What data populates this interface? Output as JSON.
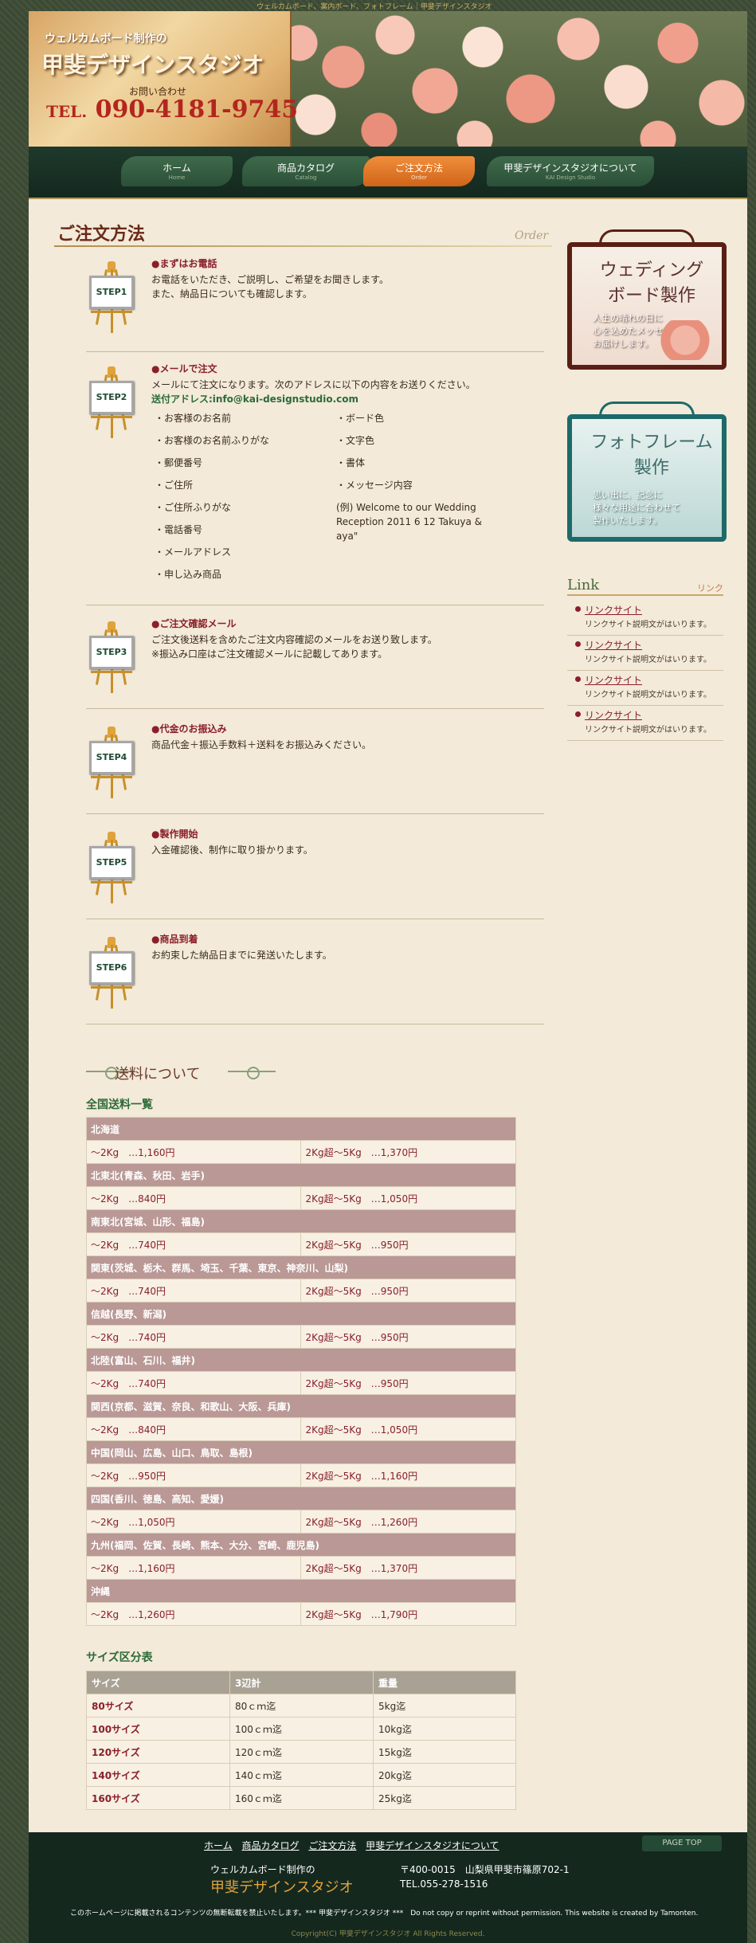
{
  "top_tagline": "ウェルカムボード、案内ボード、フォトフレーム｜甲斐デザインスタジオ",
  "header": {
    "subtitle": "ウェルカムボード制作の",
    "name": "甲斐デザインスタジオ",
    "contact_label": "お問い合わせ",
    "tel_prefix": "TEL.",
    "tel": "090-4181-9745"
  },
  "nav": [
    {
      "label": "ホーム",
      "sub": "Home"
    },
    {
      "label": "商品カタログ",
      "sub": "Catalog"
    },
    {
      "label": "ご注文方法",
      "sub": "Order"
    },
    {
      "label": "甲斐デザインスタジオについて",
      "sub": "KAI Design Studio"
    }
  ],
  "page": {
    "title": "ご注文方法",
    "title_en": "Order"
  },
  "steps": [
    {
      "badge": "STEP1",
      "heading": "●まずはお電話",
      "lines": [
        "お電話をいただき、ご説明し、ご希望をお聞きします。",
        "また、納品日についても確認します。"
      ]
    },
    {
      "badge": "STEP2",
      "heading": "●メールで注文",
      "lines": [
        "メールにて注文になります。次のアドレスに以下の内容をお送りください。"
      ],
      "address": "送付アドレス:info@kai-designstudio.com",
      "items_left": [
        "・お客様のお名前",
        "・お客様のお名前ふりがな",
        "・郵便番号",
        "・ご住所",
        "・ご住所ふりがな",
        "・電話番号",
        "・メールアドレス",
        "・申し込み商品"
      ],
      "items_right": [
        "・ボード色",
        "・文字色",
        "・書体",
        "・メッセージ内容"
      ],
      "example_1": "(例) Welcome to our Wedding",
      "example_2": "Reception 2011 6 12 Takuya &",
      "example_3": "aya\""
    },
    {
      "badge": "STEP3",
      "heading": "●ご注文確認メール",
      "lines": [
        "ご注文後送料を含めたご注文内容確認のメールをお送り致します。",
        "※振込み口座はご注文確認メールに記載してあります。"
      ]
    },
    {
      "badge": "STEP4",
      "heading": "●代金のお振込み",
      "lines": [
        "商品代金＋振込手数料＋送料をお振込みください。"
      ]
    },
    {
      "badge": "STEP5",
      "heading": "●製作開始",
      "lines": [
        "入金確認後、制作に取り掛かります。"
      ]
    },
    {
      "badge": "STEP6",
      "heading": "●商品到着",
      "lines": [
        "お約束した納品日までに発送いたします。"
      ]
    }
  ],
  "shipping": {
    "heading": "送料について",
    "table_title": "全国送料一覧",
    "regions": [
      {
        "name": "北海道",
        "a": "～2Kg　…1,160円",
        "b": "2Kg超～5Kg　…1,370円"
      },
      {
        "name": "北東北(青森、秋田、岩手)",
        "a": "～2Kg　…840円",
        "b": "2Kg超～5Kg　…1,050円"
      },
      {
        "name": "南東北(宮城、山形、福島)",
        "a": "～2Kg　…740円",
        "b": "2Kg超～5Kg　…950円"
      },
      {
        "name": "関東(茨城、栃木、群馬、埼玉、千葉、東京、神奈川、山梨)",
        "a": "～2Kg　…740円",
        "b": "2Kg超～5Kg　…950円"
      },
      {
        "name": "信越(長野、新潟)",
        "a": "～2Kg　…740円",
        "b": "2Kg超～5Kg　…950円"
      },
      {
        "name": "北陸(富山、石川、福井)",
        "a": "～2Kg　…740円",
        "b": "2Kg超～5Kg　…950円"
      },
      {
        "name": "関西(京都、滋賀、奈良、和歌山、大阪、兵庫)",
        "a": "～2Kg　…840円",
        "b": "2Kg超～5Kg　…1,050円"
      },
      {
        "name": "中国(岡山、広島、山口、鳥取、島根)",
        "a": "～2Kg　…950円",
        "b": "2Kg超～5Kg　…1,160円"
      },
      {
        "name": "四国(香川、徳島、高知、愛媛)",
        "a": "～2Kg　…1,050円",
        "b": "2Kg超～5Kg　…1,260円"
      },
      {
        "name": "九州(福岡、佐賀、長崎、熊本、大分、宮崎、鹿児島)",
        "a": "～2Kg　…1,160円",
        "b": "2Kg超～5Kg　…1,370円"
      },
      {
        "name": "沖縄",
        "a": "～2Kg　…1,260円",
        "b": "2Kg超～5Kg　…1,790円"
      }
    ]
  },
  "size": {
    "title": "サイズ区分表",
    "headers": [
      "サイズ",
      "3辺計",
      "重量"
    ],
    "rows": [
      [
        "80サイズ",
        "80ｃｍ迄",
        "5kg迄"
      ],
      [
        "100サイズ",
        "100ｃｍ迄",
        "10kg迄"
      ],
      [
        "120サイズ",
        "120ｃｍ迄",
        "15kg迄"
      ],
      [
        "140サイズ",
        "140ｃｍ迄",
        "20kg迄"
      ],
      [
        "160サイズ",
        "160ｃｍ迄",
        "25kg迄"
      ]
    ]
  },
  "sidebar": {
    "wedding": {
      "title_1": "ウェディング",
      "title_2": "ボード製作",
      "line_1": "人生の晴れの日に",
      "line_2": "心を込めたメッセージを",
      "line_3": "お届けします。"
    },
    "photo": {
      "title_1": "フォトフレーム",
      "title_2": "製作",
      "line_1": "思い出に、記念に",
      "line_2": "様々な用途に合わせて",
      "line_3": "製作いたします。"
    },
    "link_title": "Link",
    "link_title_jp": "リンク",
    "links": [
      {
        "label": "リンクサイト",
        "desc": "リンクサイト説明文がはいります。"
      },
      {
        "label": "リンクサイト",
        "desc": "リンクサイト説明文がはいります。"
      },
      {
        "label": "リンクサイト",
        "desc": "リンクサイト説明文がはいります。"
      },
      {
        "label": "リンクサイト",
        "desc": "リンクサイト説明文がはいります。"
      }
    ]
  },
  "footer": {
    "nav": [
      "ホーム",
      "商品カタログ",
      "ご注文方法",
      "甲斐デザインスタジオについて"
    ],
    "pagetop": "PAGE TOP",
    "subtitle": "ウェルカムボード制作の",
    "name": "甲斐デザインスタジオ",
    "address": "〒400-0015　山梨県甲斐市篠原702-1",
    "tel": "TEL.055-278-1516",
    "note": "このホームページに掲載されるコンテンツの無断転載を禁止いたします。*** 甲斐デザインスタジオ ***　Do not copy or reprint without permission. This website is created by Tamonten.",
    "copyright": "Copyright(C) 甲斐デザインスタジオ All Rights Reserved."
  }
}
